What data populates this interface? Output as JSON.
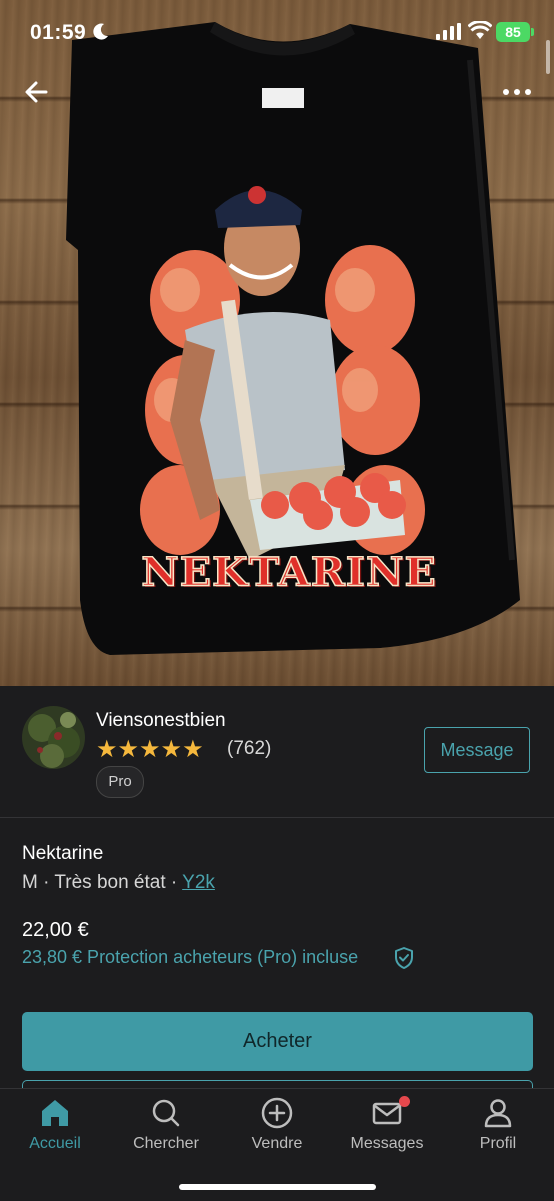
{
  "status_bar": {
    "time": "01:59",
    "battery": "85"
  },
  "photo": {
    "print_text": "NEKTARINE"
  },
  "seller": {
    "name": "Viensonestbien",
    "stars": "★★★★★",
    "review_count": "(762)",
    "badge": "Pro",
    "message_label": "Message"
  },
  "item": {
    "title": "Nektarine",
    "size": "M",
    "condition": "Très bon état",
    "separator": "·",
    "brand": "Y2k",
    "price": "22,00 €",
    "protection_price": "23,80 € Protection acheteurs (Pro) incluse"
  },
  "actions": {
    "buy_label": "Acheter"
  },
  "tabbar": {
    "accent_color": "#3f9aa5",
    "tabs": [
      {
        "label": "Accueil",
        "icon": "home-icon"
      },
      {
        "label": "Chercher",
        "icon": "search-icon"
      },
      {
        "label": "Vendre",
        "icon": "plus-circle-icon"
      },
      {
        "label": "Messages",
        "icon": "mail-icon"
      },
      {
        "label": "Profil",
        "icon": "person-icon"
      }
    ]
  }
}
